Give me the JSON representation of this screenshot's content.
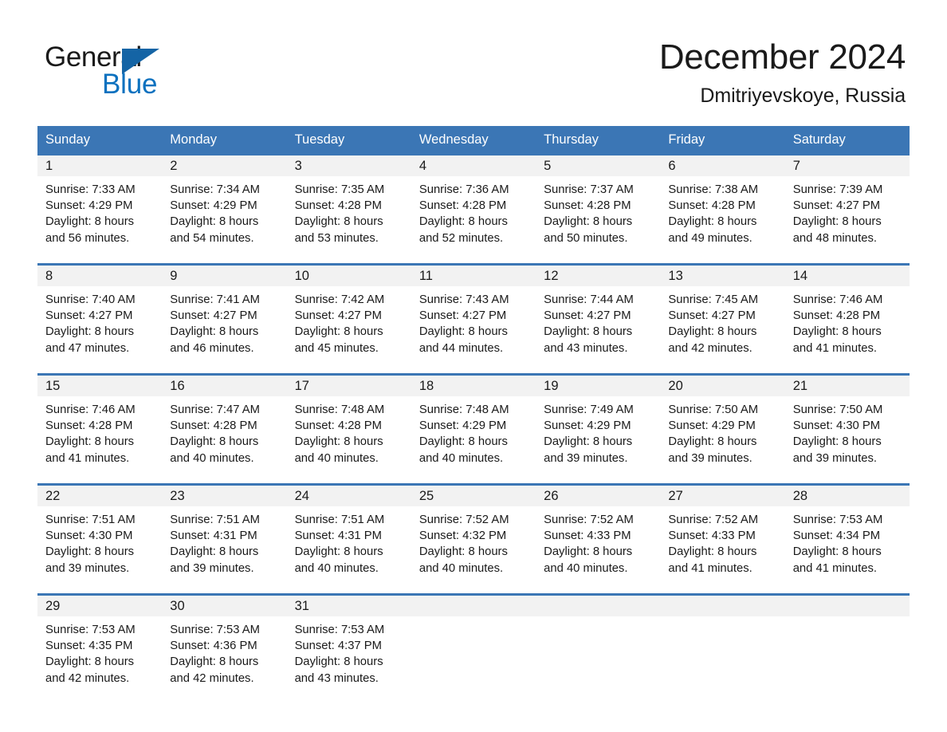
{
  "brand": {
    "name_part1": "General",
    "name_part2": "Blue",
    "triangle_color": "#1464a5",
    "blue_color": "#0b71bf"
  },
  "header": {
    "title": "December 2024",
    "subtitle": "Dmitriyevskoye, Russia"
  },
  "theme": {
    "header_blue": "#3b76b5",
    "day_band_gray": "#f2f2f2",
    "text_color": "#1a1a1a"
  },
  "weekdays": [
    "Sunday",
    "Monday",
    "Tuesday",
    "Wednesday",
    "Thursday",
    "Friday",
    "Saturday"
  ],
  "weeks": [
    [
      {
        "day": "1",
        "sunrise": "Sunrise: 7:33 AM",
        "sunset": "Sunset: 4:29 PM",
        "daylight_line1": "Daylight: 8 hours",
        "daylight_line2": "and 56 minutes."
      },
      {
        "day": "2",
        "sunrise": "Sunrise: 7:34 AM",
        "sunset": "Sunset: 4:29 PM",
        "daylight_line1": "Daylight: 8 hours",
        "daylight_line2": "and 54 minutes."
      },
      {
        "day": "3",
        "sunrise": "Sunrise: 7:35 AM",
        "sunset": "Sunset: 4:28 PM",
        "daylight_line1": "Daylight: 8 hours",
        "daylight_line2": "and 53 minutes."
      },
      {
        "day": "4",
        "sunrise": "Sunrise: 7:36 AM",
        "sunset": "Sunset: 4:28 PM",
        "daylight_line1": "Daylight: 8 hours",
        "daylight_line2": "and 52 minutes."
      },
      {
        "day": "5",
        "sunrise": "Sunrise: 7:37 AM",
        "sunset": "Sunset: 4:28 PM",
        "daylight_line1": "Daylight: 8 hours",
        "daylight_line2": "and 50 minutes."
      },
      {
        "day": "6",
        "sunrise": "Sunrise: 7:38 AM",
        "sunset": "Sunset: 4:28 PM",
        "daylight_line1": "Daylight: 8 hours",
        "daylight_line2": "and 49 minutes."
      },
      {
        "day": "7",
        "sunrise": "Sunrise: 7:39 AM",
        "sunset": "Sunset: 4:27 PM",
        "daylight_line1": "Daylight: 8 hours",
        "daylight_line2": "and 48 minutes."
      }
    ],
    [
      {
        "day": "8",
        "sunrise": "Sunrise: 7:40 AM",
        "sunset": "Sunset: 4:27 PM",
        "daylight_line1": "Daylight: 8 hours",
        "daylight_line2": "and 47 minutes."
      },
      {
        "day": "9",
        "sunrise": "Sunrise: 7:41 AM",
        "sunset": "Sunset: 4:27 PM",
        "daylight_line1": "Daylight: 8 hours",
        "daylight_line2": "and 46 minutes."
      },
      {
        "day": "10",
        "sunrise": "Sunrise: 7:42 AM",
        "sunset": "Sunset: 4:27 PM",
        "daylight_line1": "Daylight: 8 hours",
        "daylight_line2": "and 45 minutes."
      },
      {
        "day": "11",
        "sunrise": "Sunrise: 7:43 AM",
        "sunset": "Sunset: 4:27 PM",
        "daylight_line1": "Daylight: 8 hours",
        "daylight_line2": "and 44 minutes."
      },
      {
        "day": "12",
        "sunrise": "Sunrise: 7:44 AM",
        "sunset": "Sunset: 4:27 PM",
        "daylight_line1": "Daylight: 8 hours",
        "daylight_line2": "and 43 minutes."
      },
      {
        "day": "13",
        "sunrise": "Sunrise: 7:45 AM",
        "sunset": "Sunset: 4:27 PM",
        "daylight_line1": "Daylight: 8 hours",
        "daylight_line2": "and 42 minutes."
      },
      {
        "day": "14",
        "sunrise": "Sunrise: 7:46 AM",
        "sunset": "Sunset: 4:28 PM",
        "daylight_line1": "Daylight: 8 hours",
        "daylight_line2": "and 41 minutes."
      }
    ],
    [
      {
        "day": "15",
        "sunrise": "Sunrise: 7:46 AM",
        "sunset": "Sunset: 4:28 PM",
        "daylight_line1": "Daylight: 8 hours",
        "daylight_line2": "and 41 minutes."
      },
      {
        "day": "16",
        "sunrise": "Sunrise: 7:47 AM",
        "sunset": "Sunset: 4:28 PM",
        "daylight_line1": "Daylight: 8 hours",
        "daylight_line2": "and 40 minutes."
      },
      {
        "day": "17",
        "sunrise": "Sunrise: 7:48 AM",
        "sunset": "Sunset: 4:28 PM",
        "daylight_line1": "Daylight: 8 hours",
        "daylight_line2": "and 40 minutes."
      },
      {
        "day": "18",
        "sunrise": "Sunrise: 7:48 AM",
        "sunset": "Sunset: 4:29 PM",
        "daylight_line1": "Daylight: 8 hours",
        "daylight_line2": "and 40 minutes."
      },
      {
        "day": "19",
        "sunrise": "Sunrise: 7:49 AM",
        "sunset": "Sunset: 4:29 PM",
        "daylight_line1": "Daylight: 8 hours",
        "daylight_line2": "and 39 minutes."
      },
      {
        "day": "20",
        "sunrise": "Sunrise: 7:50 AM",
        "sunset": "Sunset: 4:29 PM",
        "daylight_line1": "Daylight: 8 hours",
        "daylight_line2": "and 39 minutes."
      },
      {
        "day": "21",
        "sunrise": "Sunrise: 7:50 AM",
        "sunset": "Sunset: 4:30 PM",
        "daylight_line1": "Daylight: 8 hours",
        "daylight_line2": "and 39 minutes."
      }
    ],
    [
      {
        "day": "22",
        "sunrise": "Sunrise: 7:51 AM",
        "sunset": "Sunset: 4:30 PM",
        "daylight_line1": "Daylight: 8 hours",
        "daylight_line2": "and 39 minutes."
      },
      {
        "day": "23",
        "sunrise": "Sunrise: 7:51 AM",
        "sunset": "Sunset: 4:31 PM",
        "daylight_line1": "Daylight: 8 hours",
        "daylight_line2": "and 39 minutes."
      },
      {
        "day": "24",
        "sunrise": "Sunrise: 7:51 AM",
        "sunset": "Sunset: 4:31 PM",
        "daylight_line1": "Daylight: 8 hours",
        "daylight_line2": "and 40 minutes."
      },
      {
        "day": "25",
        "sunrise": "Sunrise: 7:52 AM",
        "sunset": "Sunset: 4:32 PM",
        "daylight_line1": "Daylight: 8 hours",
        "daylight_line2": "and 40 minutes."
      },
      {
        "day": "26",
        "sunrise": "Sunrise: 7:52 AM",
        "sunset": "Sunset: 4:33 PM",
        "daylight_line1": "Daylight: 8 hours",
        "daylight_line2": "and 40 minutes."
      },
      {
        "day": "27",
        "sunrise": "Sunrise: 7:52 AM",
        "sunset": "Sunset: 4:33 PM",
        "daylight_line1": "Daylight: 8 hours",
        "daylight_line2": "and 41 minutes."
      },
      {
        "day": "28",
        "sunrise": "Sunrise: 7:53 AM",
        "sunset": "Sunset: 4:34 PM",
        "daylight_line1": "Daylight: 8 hours",
        "daylight_line2": "and 41 minutes."
      }
    ],
    [
      {
        "day": "29",
        "sunrise": "Sunrise: 7:53 AM",
        "sunset": "Sunset: 4:35 PM",
        "daylight_line1": "Daylight: 8 hours",
        "daylight_line2": "and 42 minutes."
      },
      {
        "day": "30",
        "sunrise": "Sunrise: 7:53 AM",
        "sunset": "Sunset: 4:36 PM",
        "daylight_line1": "Daylight: 8 hours",
        "daylight_line2": "and 42 minutes."
      },
      {
        "day": "31",
        "sunrise": "Sunrise: 7:53 AM",
        "sunset": "Sunset: 4:37 PM",
        "daylight_line1": "Daylight: 8 hours",
        "daylight_line2": "and 43 minutes."
      },
      {
        "day": "",
        "sunrise": "",
        "sunset": "",
        "daylight_line1": "",
        "daylight_line2": ""
      },
      {
        "day": "",
        "sunrise": "",
        "sunset": "",
        "daylight_line1": "",
        "daylight_line2": ""
      },
      {
        "day": "",
        "sunrise": "",
        "sunset": "",
        "daylight_line1": "",
        "daylight_line2": ""
      },
      {
        "day": "",
        "sunrise": "",
        "sunset": "",
        "daylight_line1": "",
        "daylight_line2": ""
      }
    ]
  ]
}
